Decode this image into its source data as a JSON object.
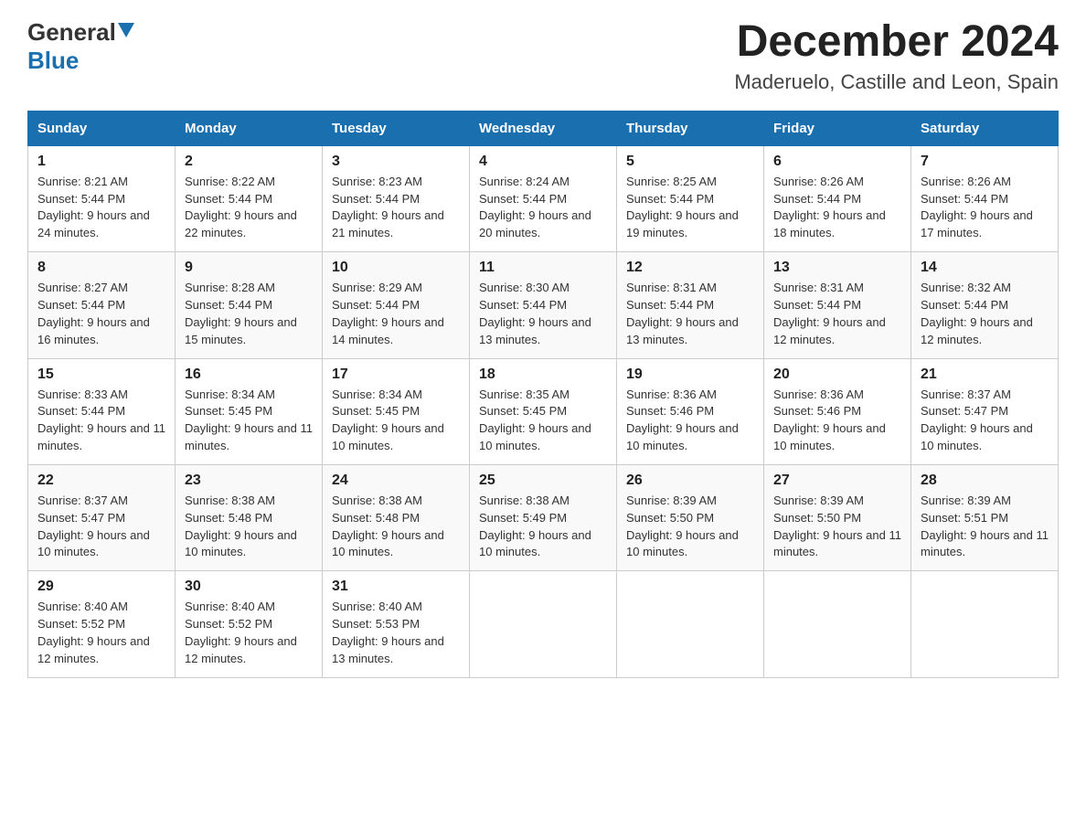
{
  "header": {
    "logo_general": "General",
    "logo_blue": "Blue",
    "title": "December 2024",
    "subtitle": "Maderuelo, Castille and Leon, Spain"
  },
  "days_of_week": [
    "Sunday",
    "Monday",
    "Tuesday",
    "Wednesday",
    "Thursday",
    "Friday",
    "Saturday"
  ],
  "weeks": [
    [
      {
        "day": "1",
        "sunrise": "8:21 AM",
        "sunset": "5:44 PM",
        "daylight": "9 hours and 24 minutes."
      },
      {
        "day": "2",
        "sunrise": "8:22 AM",
        "sunset": "5:44 PM",
        "daylight": "9 hours and 22 minutes."
      },
      {
        "day": "3",
        "sunrise": "8:23 AM",
        "sunset": "5:44 PM",
        "daylight": "9 hours and 21 minutes."
      },
      {
        "day": "4",
        "sunrise": "8:24 AM",
        "sunset": "5:44 PM",
        "daylight": "9 hours and 20 minutes."
      },
      {
        "day": "5",
        "sunrise": "8:25 AM",
        "sunset": "5:44 PM",
        "daylight": "9 hours and 19 minutes."
      },
      {
        "day": "6",
        "sunrise": "8:26 AM",
        "sunset": "5:44 PM",
        "daylight": "9 hours and 18 minutes."
      },
      {
        "day": "7",
        "sunrise": "8:26 AM",
        "sunset": "5:44 PM",
        "daylight": "9 hours and 17 minutes."
      }
    ],
    [
      {
        "day": "8",
        "sunrise": "8:27 AM",
        "sunset": "5:44 PM",
        "daylight": "9 hours and 16 minutes."
      },
      {
        "day": "9",
        "sunrise": "8:28 AM",
        "sunset": "5:44 PM",
        "daylight": "9 hours and 15 minutes."
      },
      {
        "day": "10",
        "sunrise": "8:29 AM",
        "sunset": "5:44 PM",
        "daylight": "9 hours and 14 minutes."
      },
      {
        "day": "11",
        "sunrise": "8:30 AM",
        "sunset": "5:44 PM",
        "daylight": "9 hours and 13 minutes."
      },
      {
        "day": "12",
        "sunrise": "8:31 AM",
        "sunset": "5:44 PM",
        "daylight": "9 hours and 13 minutes."
      },
      {
        "day": "13",
        "sunrise": "8:31 AM",
        "sunset": "5:44 PM",
        "daylight": "9 hours and 12 minutes."
      },
      {
        "day": "14",
        "sunrise": "8:32 AM",
        "sunset": "5:44 PM",
        "daylight": "9 hours and 12 minutes."
      }
    ],
    [
      {
        "day": "15",
        "sunrise": "8:33 AM",
        "sunset": "5:44 PM",
        "daylight": "9 hours and 11 minutes."
      },
      {
        "day": "16",
        "sunrise": "8:34 AM",
        "sunset": "5:45 PM",
        "daylight": "9 hours and 11 minutes."
      },
      {
        "day": "17",
        "sunrise": "8:34 AM",
        "sunset": "5:45 PM",
        "daylight": "9 hours and 10 minutes."
      },
      {
        "day": "18",
        "sunrise": "8:35 AM",
        "sunset": "5:45 PM",
        "daylight": "9 hours and 10 minutes."
      },
      {
        "day": "19",
        "sunrise": "8:36 AM",
        "sunset": "5:46 PM",
        "daylight": "9 hours and 10 minutes."
      },
      {
        "day": "20",
        "sunrise": "8:36 AM",
        "sunset": "5:46 PM",
        "daylight": "9 hours and 10 minutes."
      },
      {
        "day": "21",
        "sunrise": "8:37 AM",
        "sunset": "5:47 PM",
        "daylight": "9 hours and 10 minutes."
      }
    ],
    [
      {
        "day": "22",
        "sunrise": "8:37 AM",
        "sunset": "5:47 PM",
        "daylight": "9 hours and 10 minutes."
      },
      {
        "day": "23",
        "sunrise": "8:38 AM",
        "sunset": "5:48 PM",
        "daylight": "9 hours and 10 minutes."
      },
      {
        "day": "24",
        "sunrise": "8:38 AM",
        "sunset": "5:48 PM",
        "daylight": "9 hours and 10 minutes."
      },
      {
        "day": "25",
        "sunrise": "8:38 AM",
        "sunset": "5:49 PM",
        "daylight": "9 hours and 10 minutes."
      },
      {
        "day": "26",
        "sunrise": "8:39 AM",
        "sunset": "5:50 PM",
        "daylight": "9 hours and 10 minutes."
      },
      {
        "day": "27",
        "sunrise": "8:39 AM",
        "sunset": "5:50 PM",
        "daylight": "9 hours and 11 minutes."
      },
      {
        "day": "28",
        "sunrise": "8:39 AM",
        "sunset": "5:51 PM",
        "daylight": "9 hours and 11 minutes."
      }
    ],
    [
      {
        "day": "29",
        "sunrise": "8:40 AM",
        "sunset": "5:52 PM",
        "daylight": "9 hours and 12 minutes."
      },
      {
        "day": "30",
        "sunrise": "8:40 AM",
        "sunset": "5:52 PM",
        "daylight": "9 hours and 12 minutes."
      },
      {
        "day": "31",
        "sunrise": "8:40 AM",
        "sunset": "5:53 PM",
        "daylight": "9 hours and 13 minutes."
      },
      null,
      null,
      null,
      null
    ]
  ],
  "labels": {
    "sunrise": "Sunrise:",
    "sunset": "Sunset:",
    "daylight": "Daylight:"
  }
}
